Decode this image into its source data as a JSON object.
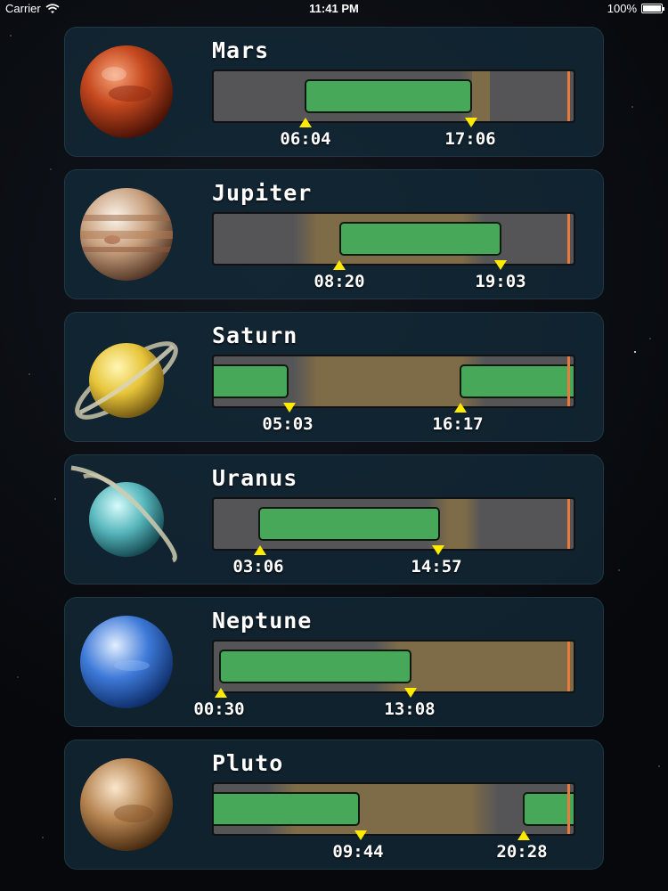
{
  "status": {
    "carrier": "Carrier",
    "time": "11:41 PM",
    "battery": "100%"
  },
  "planets": [
    {
      "name": "Mars",
      "rise": "06:04",
      "set": "17:06"
    },
    {
      "name": "Jupiter",
      "rise": "08:20",
      "set": "19:03"
    },
    {
      "name": "Saturn",
      "rise": "16:17",
      "set": "05:03"
    },
    {
      "name": "Uranus",
      "rise": "03:06",
      "set": "14:57"
    },
    {
      "name": "Neptune",
      "rise": "00:30",
      "set": "13:08"
    },
    {
      "name": "Pluto",
      "rise": "20:28",
      "set": "09:44"
    }
  ],
  "colors": {
    "visible_bar": "#47a85a",
    "daylight_band": "#7e6b47",
    "night_band": "#555558",
    "now_marker": "#e87a3e",
    "rise_marker": "#ffea00",
    "card_background": "#142d3c"
  }
}
